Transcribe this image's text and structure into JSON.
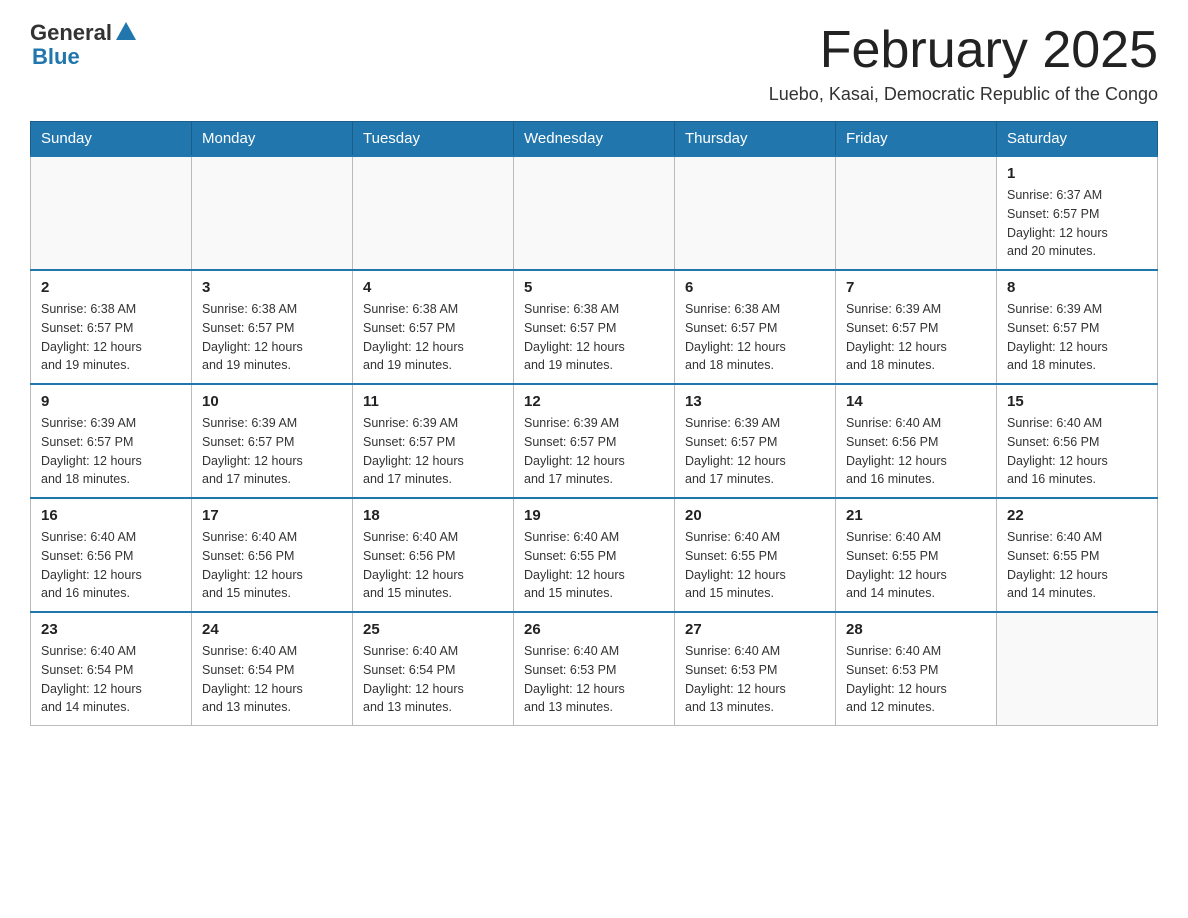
{
  "header": {
    "logo_general": "General",
    "logo_blue": "Blue",
    "month_title": "February 2025",
    "subtitle": "Luebo, Kasai, Democratic Republic of the Congo"
  },
  "weekdays": [
    "Sunday",
    "Monday",
    "Tuesday",
    "Wednesday",
    "Thursday",
    "Friday",
    "Saturday"
  ],
  "weeks": [
    [
      {
        "day": "",
        "info": ""
      },
      {
        "day": "",
        "info": ""
      },
      {
        "day": "",
        "info": ""
      },
      {
        "day": "",
        "info": ""
      },
      {
        "day": "",
        "info": ""
      },
      {
        "day": "",
        "info": ""
      },
      {
        "day": "1",
        "info": "Sunrise: 6:37 AM\nSunset: 6:57 PM\nDaylight: 12 hours\nand 20 minutes."
      }
    ],
    [
      {
        "day": "2",
        "info": "Sunrise: 6:38 AM\nSunset: 6:57 PM\nDaylight: 12 hours\nand 19 minutes."
      },
      {
        "day": "3",
        "info": "Sunrise: 6:38 AM\nSunset: 6:57 PM\nDaylight: 12 hours\nand 19 minutes."
      },
      {
        "day": "4",
        "info": "Sunrise: 6:38 AM\nSunset: 6:57 PM\nDaylight: 12 hours\nand 19 minutes."
      },
      {
        "day": "5",
        "info": "Sunrise: 6:38 AM\nSunset: 6:57 PM\nDaylight: 12 hours\nand 19 minutes."
      },
      {
        "day": "6",
        "info": "Sunrise: 6:38 AM\nSunset: 6:57 PM\nDaylight: 12 hours\nand 18 minutes."
      },
      {
        "day": "7",
        "info": "Sunrise: 6:39 AM\nSunset: 6:57 PM\nDaylight: 12 hours\nand 18 minutes."
      },
      {
        "day": "8",
        "info": "Sunrise: 6:39 AM\nSunset: 6:57 PM\nDaylight: 12 hours\nand 18 minutes."
      }
    ],
    [
      {
        "day": "9",
        "info": "Sunrise: 6:39 AM\nSunset: 6:57 PM\nDaylight: 12 hours\nand 18 minutes."
      },
      {
        "day": "10",
        "info": "Sunrise: 6:39 AM\nSunset: 6:57 PM\nDaylight: 12 hours\nand 17 minutes."
      },
      {
        "day": "11",
        "info": "Sunrise: 6:39 AM\nSunset: 6:57 PM\nDaylight: 12 hours\nand 17 minutes."
      },
      {
        "day": "12",
        "info": "Sunrise: 6:39 AM\nSunset: 6:57 PM\nDaylight: 12 hours\nand 17 minutes."
      },
      {
        "day": "13",
        "info": "Sunrise: 6:39 AM\nSunset: 6:57 PM\nDaylight: 12 hours\nand 17 minutes."
      },
      {
        "day": "14",
        "info": "Sunrise: 6:40 AM\nSunset: 6:56 PM\nDaylight: 12 hours\nand 16 minutes."
      },
      {
        "day": "15",
        "info": "Sunrise: 6:40 AM\nSunset: 6:56 PM\nDaylight: 12 hours\nand 16 minutes."
      }
    ],
    [
      {
        "day": "16",
        "info": "Sunrise: 6:40 AM\nSunset: 6:56 PM\nDaylight: 12 hours\nand 16 minutes."
      },
      {
        "day": "17",
        "info": "Sunrise: 6:40 AM\nSunset: 6:56 PM\nDaylight: 12 hours\nand 15 minutes."
      },
      {
        "day": "18",
        "info": "Sunrise: 6:40 AM\nSunset: 6:56 PM\nDaylight: 12 hours\nand 15 minutes."
      },
      {
        "day": "19",
        "info": "Sunrise: 6:40 AM\nSunset: 6:55 PM\nDaylight: 12 hours\nand 15 minutes."
      },
      {
        "day": "20",
        "info": "Sunrise: 6:40 AM\nSunset: 6:55 PM\nDaylight: 12 hours\nand 15 minutes."
      },
      {
        "day": "21",
        "info": "Sunrise: 6:40 AM\nSunset: 6:55 PM\nDaylight: 12 hours\nand 14 minutes."
      },
      {
        "day": "22",
        "info": "Sunrise: 6:40 AM\nSunset: 6:55 PM\nDaylight: 12 hours\nand 14 minutes."
      }
    ],
    [
      {
        "day": "23",
        "info": "Sunrise: 6:40 AM\nSunset: 6:54 PM\nDaylight: 12 hours\nand 14 minutes."
      },
      {
        "day": "24",
        "info": "Sunrise: 6:40 AM\nSunset: 6:54 PM\nDaylight: 12 hours\nand 13 minutes."
      },
      {
        "day": "25",
        "info": "Sunrise: 6:40 AM\nSunset: 6:54 PM\nDaylight: 12 hours\nand 13 minutes."
      },
      {
        "day": "26",
        "info": "Sunrise: 6:40 AM\nSunset: 6:53 PM\nDaylight: 12 hours\nand 13 minutes."
      },
      {
        "day": "27",
        "info": "Sunrise: 6:40 AM\nSunset: 6:53 PM\nDaylight: 12 hours\nand 13 minutes."
      },
      {
        "day": "28",
        "info": "Sunrise: 6:40 AM\nSunset: 6:53 PM\nDaylight: 12 hours\nand 12 minutes."
      },
      {
        "day": "",
        "info": ""
      }
    ]
  ]
}
